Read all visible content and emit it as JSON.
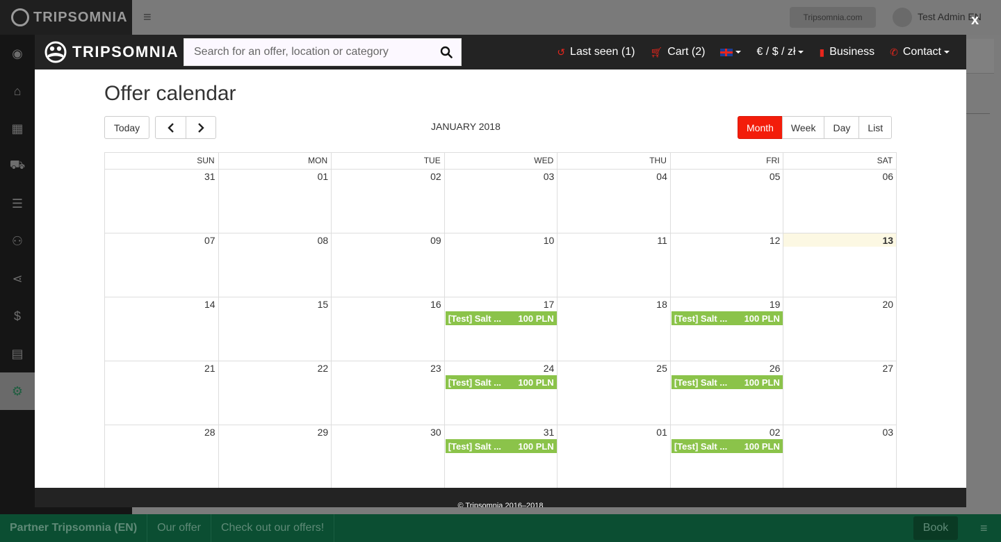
{
  "admin": {
    "brand": "TRIPSOMNIA",
    "site_button": "Tripsomnia.com",
    "user_name": "Test Admin EN",
    "close_label": "x"
  },
  "modal": {
    "brand": "TRIPSOMNIA",
    "search_placeholder": "Search for an offer, location or category",
    "nav": {
      "last_seen": "Last seen (1)",
      "cart": "Cart (2)",
      "currency": "€ / $ / zł",
      "business": "Business",
      "contact": "Contact"
    },
    "accent_color": "#e8261c"
  },
  "calendar": {
    "page_title": "Offer calendar",
    "today_label": "Today",
    "month_title": "JANUARY 2018",
    "views": [
      "Month",
      "Week",
      "Day",
      "List"
    ],
    "active_view": "Month",
    "day_headers": [
      "SUN",
      "MON",
      "TUE",
      "WED",
      "THU",
      "FRI",
      "SAT"
    ],
    "weeks": [
      [
        "31",
        "01",
        "02",
        "03",
        "04",
        "05",
        "06"
      ],
      [
        "07",
        "08",
        "09",
        "10",
        "11",
        "12",
        "13"
      ],
      [
        "14",
        "15",
        "16",
        "17",
        "18",
        "19",
        "20"
      ],
      [
        "21",
        "22",
        "23",
        "24",
        "25",
        "26",
        "27"
      ],
      [
        "28",
        "29",
        "30",
        "31",
        "01",
        "02",
        "03"
      ]
    ],
    "today": "13",
    "event_color": "#8bc34a",
    "events": [
      {
        "week": 2,
        "day": 3,
        "title": "[Test] Salt ...",
        "price": "100 PLN"
      },
      {
        "week": 2,
        "day": 5,
        "title": "[Test] Salt ...",
        "price": "100 PLN"
      },
      {
        "week": 3,
        "day": 3,
        "title": "[Test] Salt ...",
        "price": "100 PLN"
      },
      {
        "week": 3,
        "day": 5,
        "title": "[Test] Salt ...",
        "price": "100 PLN"
      },
      {
        "week": 4,
        "day": 3,
        "title": "[Test] Salt ...",
        "price": "100 PLN"
      },
      {
        "week": 4,
        "day": 5,
        "title": "[Test] Salt ...",
        "price": "100 PLN"
      }
    ]
  },
  "footer": {
    "copyright": "© Tripsomnia 2016–2018"
  },
  "bottom_bar": {
    "items": [
      "Partner Tripsomnia (EN)",
      "Our offer",
      "Check out our offers!"
    ],
    "book_label": "Book"
  }
}
